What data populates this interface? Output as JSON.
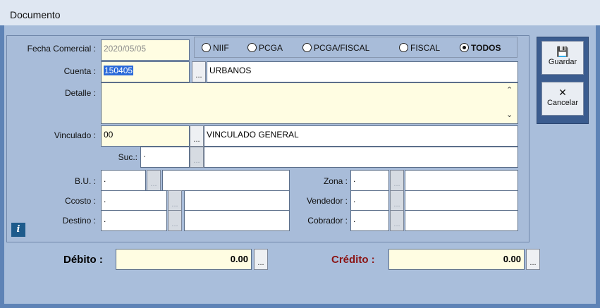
{
  "window": {
    "title": "Documento"
  },
  "form": {
    "fecha_label": "Fecha Comercial :",
    "fecha_value": "2020/05/05",
    "radios": [
      {
        "label": "NIIF",
        "selected": false
      },
      {
        "label": "PCGA",
        "selected": false
      },
      {
        "label": "PCGA/FISCAL",
        "selected": false
      },
      {
        "label": "FISCAL",
        "selected": false
      },
      {
        "label": "TODOS",
        "selected": true
      }
    ],
    "cuenta_label": "Cuenta :",
    "cuenta_value": "150405",
    "cuenta_desc": "URBANOS",
    "detalle_label": "Detalle :",
    "detalle_value": "",
    "vinculado_label": "Vinculado :",
    "vinculado_value": "00",
    "vinculado_desc": "VINCULADO GENERAL",
    "suc_label": "Suc.:",
    "suc_value": "·",
    "bu_label": "B.U. :",
    "bu_value": ".",
    "ccosto_label": "Ccosto :",
    "ccosto_value": ".",
    "destino_label": "Destino :",
    "destino_value": ".",
    "zona_label": "Zona :",
    "zona_value": ".",
    "vendedor_label": "Vendedor :",
    "vendedor_value": ".",
    "cobrador_label": "Cobrador :",
    "cobrador_value": "."
  },
  "buttons": {
    "dots": "...",
    "guardar": "Guardar",
    "cancelar": "Cancelar",
    "info": "i"
  },
  "totals": {
    "debito_label": "Débito :",
    "debito_value": "0.00",
    "credito_label": "Crédito :",
    "credito_value": "0.00"
  },
  "colors": {
    "background": "#5e83b6",
    "panel": "#a8bcd9",
    "field_yellow": "#fffde2",
    "selection": "#2b6ad9",
    "credito_label": "#8b1414"
  },
  "icons": [
    "save-icon",
    "cancel-icon",
    "info-icon",
    "scroll-up-icon",
    "scroll-down-icon"
  ]
}
